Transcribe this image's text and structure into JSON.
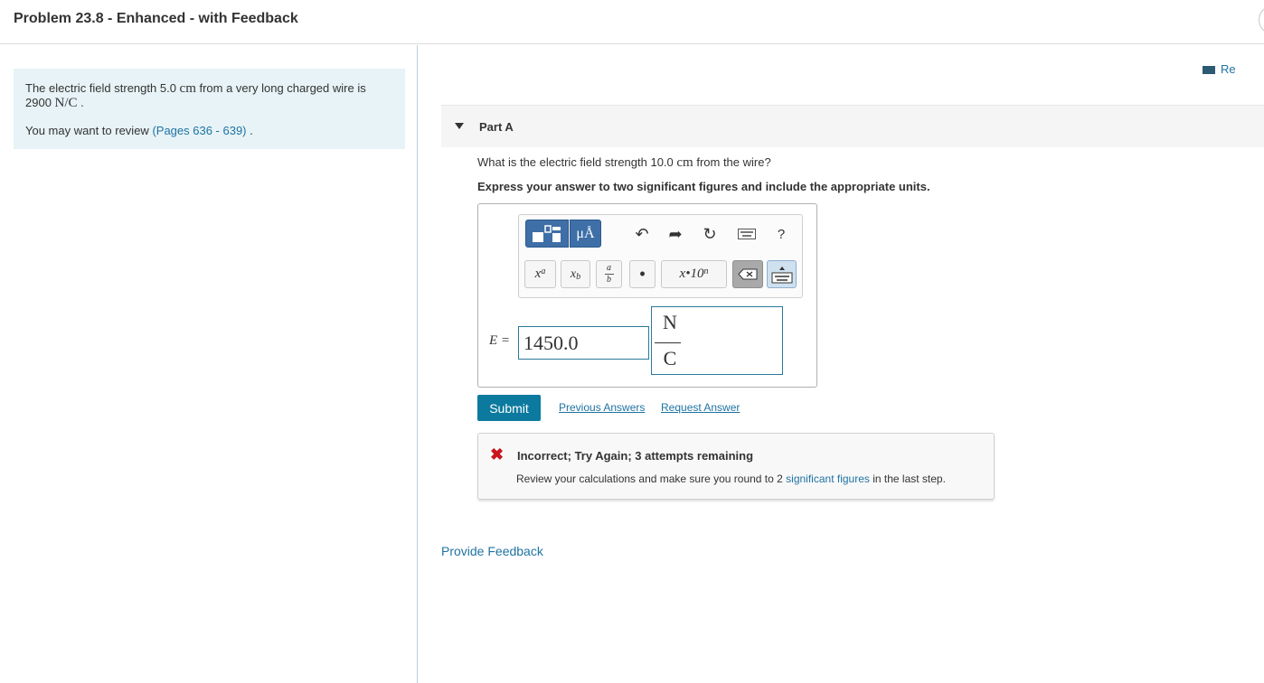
{
  "header": {
    "title": "Problem 23.8 - Enhanced - with Feedback"
  },
  "intro": {
    "text_before": "The electric field strength 5.0 ",
    "unit_cm": "cm",
    "text_mid": " from a very long charged wire is 2900 ",
    "unit_nc": "N/C",
    "text_end": " .",
    "review_text": "You may want to review ",
    "review_link": "(Pages 636 - 639)",
    "review_end": " ."
  },
  "review_link": "Re",
  "part": {
    "label": "Part A",
    "question_before": "What is the electric field strength 10.0 ",
    "question_unit": "cm",
    "question_after": " from the wire?",
    "instruction": "Express your answer to two significant figures and include the appropriate units."
  },
  "toolbar": {
    "units_label": "μÅ",
    "help_label": "?",
    "sup_label": "xa",
    "sub_label": "xb",
    "frac_num": "a",
    "frac_den": "b",
    "dot_label": "•",
    "sci_label": "x•10n"
  },
  "answer": {
    "var_label": "E =",
    "value": "1450.0",
    "unit_numerator": "N",
    "unit_denominator": "C"
  },
  "actions": {
    "submit": "Submit",
    "previous_answers": "Previous Answers",
    "request_answer": "Request Answer"
  },
  "feedback": {
    "status": "Incorrect; Try Again; 3 attempts remaining",
    "message_before": "Review your calculations and make sure you round to 2 ",
    "message_link": "significant figures",
    "message_after": " in the last step."
  },
  "footer": {
    "provide_feedback": "Provide Feedback"
  },
  "colors": {
    "accent": "#0c7a9e",
    "error": "#c8141e",
    "link": "#1f73a3",
    "intro_bg": "#e7f3f6"
  }
}
